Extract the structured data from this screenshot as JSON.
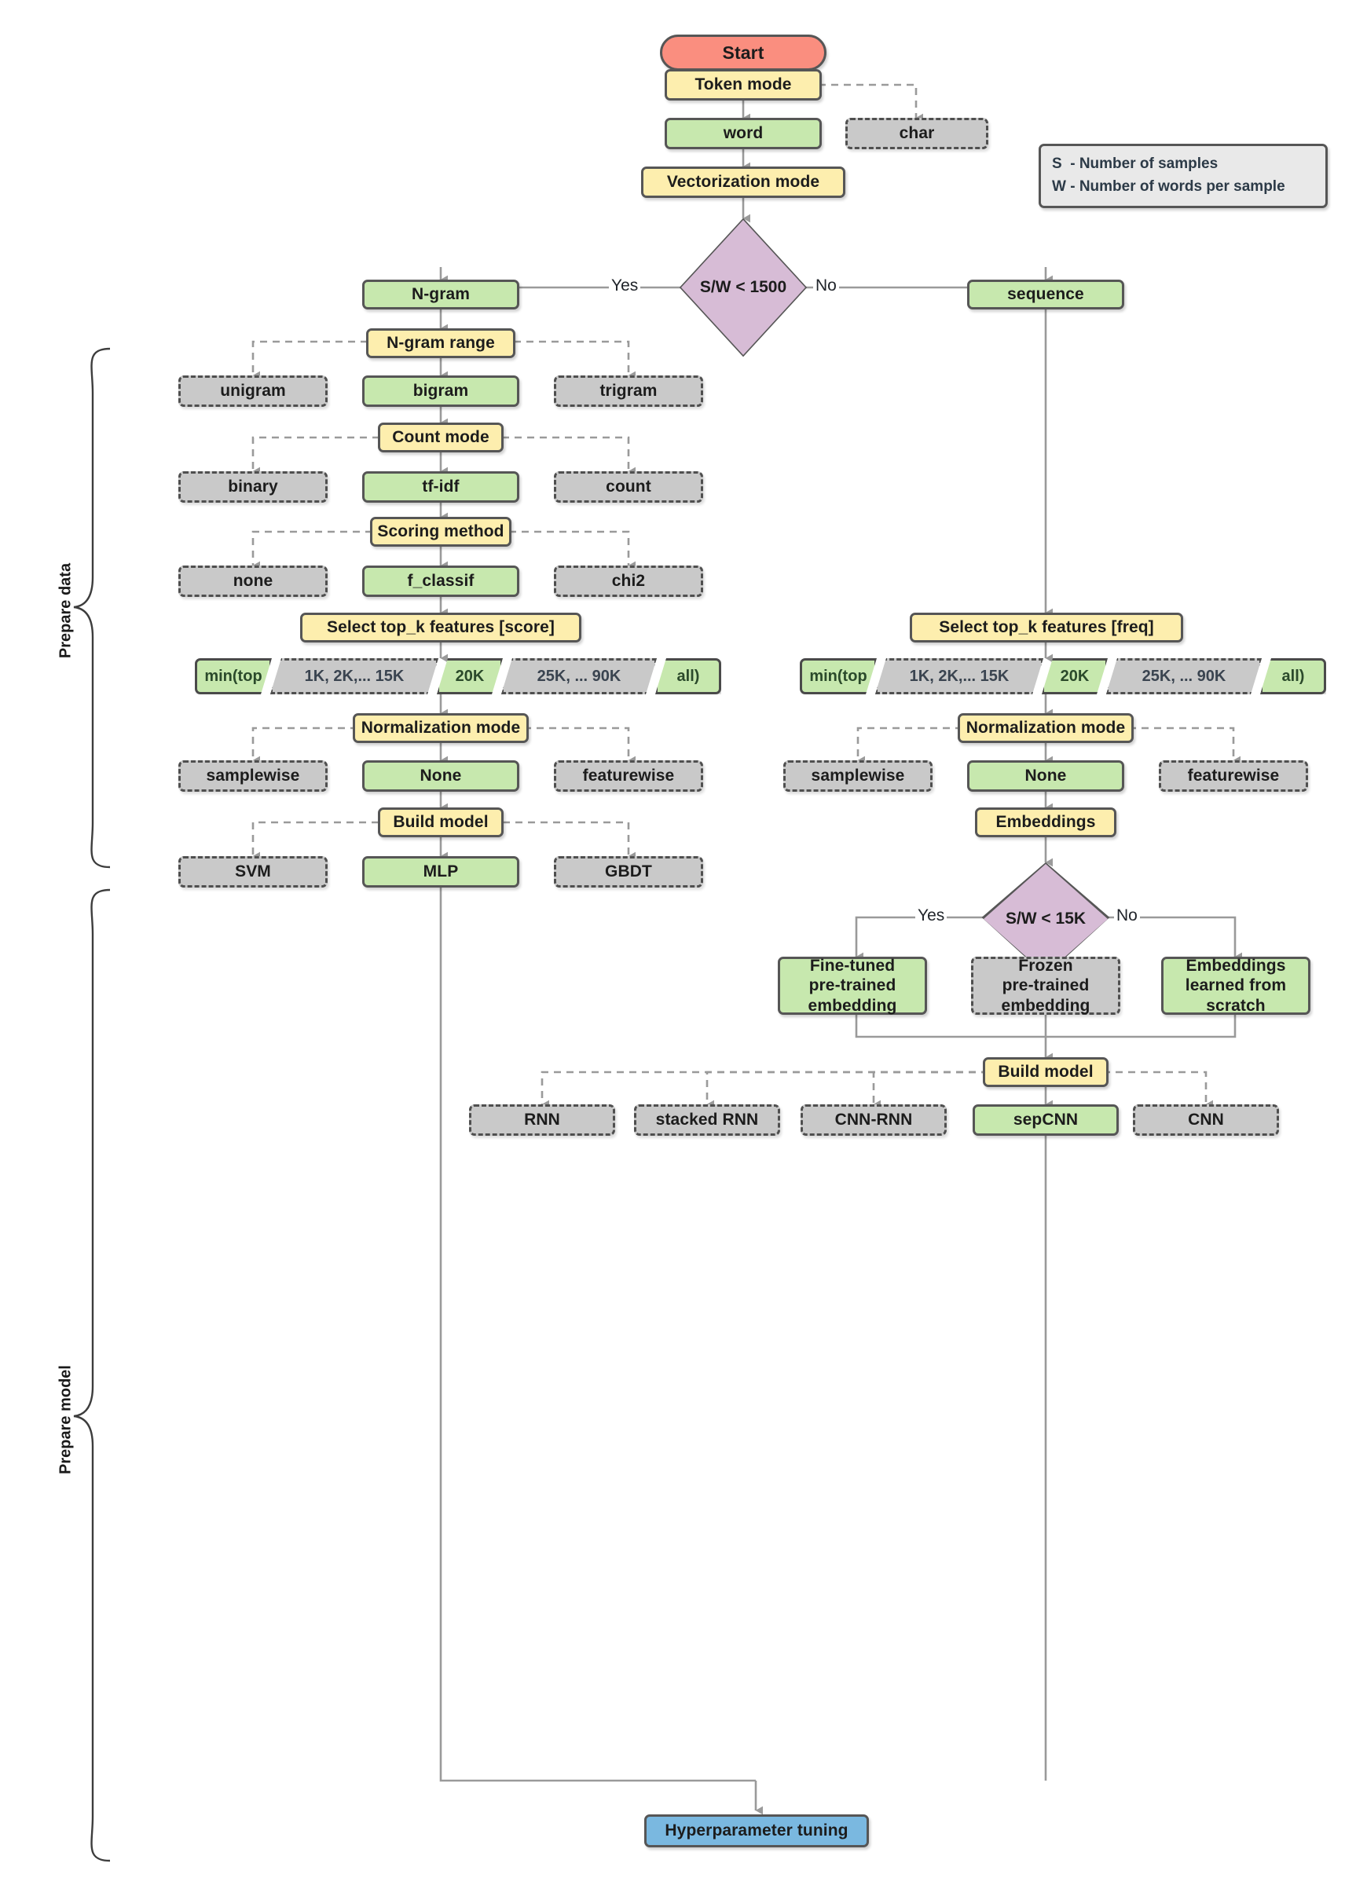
{
  "diagram": {
    "title": "Text classification workflow flowchart",
    "legend": {
      "line1": "S  - Number of samples",
      "line2": "W - Number of words per sample"
    },
    "side_labels": {
      "prepare_data": "Prepare data",
      "prepare_model": "Prepare model"
    },
    "edge_labels": {
      "yes1": "Yes",
      "no1": "No",
      "yes2": "Yes",
      "no2": "No"
    },
    "nodes": {
      "start": "Start",
      "token_mode": "Token mode",
      "word": "word",
      "char": "char",
      "vectorization_mode": "Vectorization mode",
      "decision_sw1500": "S/W < 1500",
      "ngram": "N-gram",
      "sequence": "sequence",
      "ngram_range": "N-gram range",
      "unigram": "unigram",
      "bigram": "bigram",
      "trigram": "trigram",
      "count_mode": "Count mode",
      "binary": "binary",
      "tfidf": "tf-idf",
      "count": "count",
      "scoring_method": "Scoring method",
      "none_score": "none",
      "f_classif": "f_classif",
      "chi2": "chi2",
      "select_topk_score": "Select top_k features [score]",
      "select_topk_freq": "Select top_k features [freq]",
      "normalization_mode_left": "Normalization mode",
      "samplewise_left": "samplewise",
      "none_norm_left": "None",
      "featurewise_left": "featurewise",
      "normalization_mode_right": "Normalization mode",
      "samplewise_right": "samplewise",
      "none_norm_right": "None",
      "featurewise_right": "featurewise",
      "build_model_left": "Build model",
      "svm": "SVM",
      "mlp": "MLP",
      "gbdt": "GBDT",
      "embeddings": "Embeddings",
      "decision_sw15k": "S/W < 15K",
      "fine_tuned": "Fine-tuned\npre-trained\nembedding",
      "frozen": "Frozen\npre-trained\nembedding",
      "from_scratch": "Embeddings\nlearned from\nscratch",
      "build_model_right": "Build model",
      "rnn": "RNN",
      "stacked_rnn": "stacked RNN",
      "cnn_rnn": "CNN-RNN",
      "sepcnn": "sepCNN",
      "cnn": "CNN",
      "hyperparameter_tuning": "Hyperparameter tuning"
    },
    "topk_left": [
      {
        "label": "min(top",
        "state": "selected"
      },
      {
        "label": "1K, 2K,... 15K",
        "state": "inactive"
      },
      {
        "label": "20K",
        "state": "selected"
      },
      {
        "label": "25K, ... 90K",
        "state": "inactive"
      },
      {
        "label": "all)",
        "state": "selected"
      }
    ],
    "topk_right": [
      {
        "label": "min(top",
        "state": "selected"
      },
      {
        "label": "1K, 2K,... 15K",
        "state": "inactive"
      },
      {
        "label": "20K",
        "state": "selected"
      },
      {
        "label": "25K, ... 90K",
        "state": "inactive"
      },
      {
        "label": "all)",
        "state": "selected"
      }
    ],
    "colors": {
      "start": "#fa8e7f",
      "decision": "#d7bcd6",
      "process": "#fdeeae",
      "selected": "#c7e8ae",
      "inactive": "#c9c9c9",
      "terminal": "#7ab8e0",
      "legend_bg": "#e9e9e9",
      "stroke": "#565656",
      "connector": "#9a9a9a"
    }
  }
}
